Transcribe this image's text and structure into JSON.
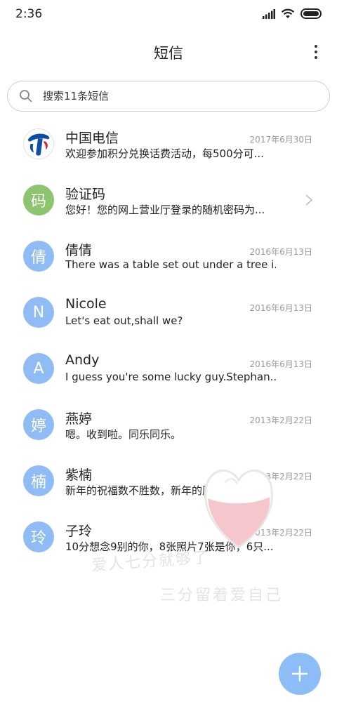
{
  "status_bar": {
    "time": "2:36",
    "icons": [
      "signal-icon",
      "wifi-icon",
      "battery-icon"
    ]
  },
  "header": {
    "title": "短信",
    "more_icon": "more-vertical-icon"
  },
  "search": {
    "placeholder": "搜索11条短信",
    "icon": "search-icon"
  },
  "conversations": [
    {
      "name": "中国电信",
      "preview": "欢迎参加积分兑换话费活动，每500分可...",
      "date": "2017年6月30日",
      "avatar_type": "telecom-logo"
    },
    {
      "name": "验证码",
      "preview": "您好！您的网上营业厅登录的随机密码为...",
      "date": "",
      "avatar_text": "码",
      "avatar_color": "#8dc56e",
      "chevron": "chevron-right-icon"
    },
    {
      "name": "倩倩",
      "preview": "There was a table set out under a tree i...",
      "date": "2016年6月13日",
      "avatar_text": "倩",
      "avatar_color": "#8fbcf5"
    },
    {
      "name": "Nicole",
      "preview": "Let's eat out,shall we?",
      "date": "2016年6月13日",
      "avatar_text": "N",
      "avatar_color": "#8fbcf5"
    },
    {
      "name": "Andy",
      "preview": "I guess you're some lucky guy.Stephan...",
      "date": "2016年6月13日",
      "avatar_text": "A",
      "avatar_color": "#8fbcf5"
    },
    {
      "name": "燕婷",
      "preview": "嗯。收到啦。同乐同乐。",
      "date": "2013年2月22日",
      "avatar_text": "婷",
      "avatar_color": "#8fbcf5"
    },
    {
      "name": "紫楠",
      "preview": "新年的祝福数不胜数，新年的愿望好多好...",
      "date": "2013年2月22日",
      "avatar_text": "楠",
      "avatar_color": "#8fbcf5"
    },
    {
      "name": "子玲",
      "preview": "10分想念9别的你，8张照片7张是你，6只...",
      "date": "2013年2月22日",
      "avatar_text": "玲",
      "avatar_color": "#8fbcf5"
    }
  ],
  "watermark": {
    "line1": "爱人七分就够了",
    "line2": "三分留着爱自己"
  },
  "fab": {
    "icon": "plus-icon",
    "color": "#8cbdf6"
  },
  "colors": {
    "accent": "#8fbcf5",
    "green_avatar": "#8dc56e",
    "date_text": "#9a9a9a"
  }
}
